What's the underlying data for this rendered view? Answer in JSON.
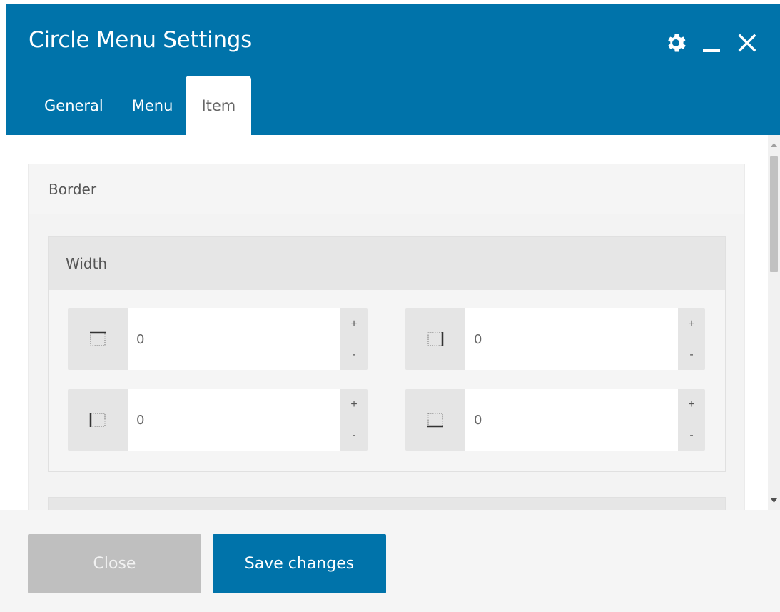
{
  "window": {
    "title": "Circle Menu Settings",
    "icons": [
      "gear-icon",
      "minimize-icon",
      "close-icon"
    ]
  },
  "tabs": [
    {
      "label": "General",
      "active": false
    },
    {
      "label": "Menu",
      "active": false
    },
    {
      "label": "Item",
      "active": true
    }
  ],
  "border_section": {
    "title": "Border",
    "width_panel": {
      "title": "Width",
      "fields": [
        {
          "side": "top",
          "icon": "border-top-icon",
          "value": "0",
          "plus": "+",
          "minus": "-"
        },
        {
          "side": "right",
          "icon": "border-right-icon",
          "value": "0",
          "plus": "+",
          "minus": "-"
        },
        {
          "side": "left",
          "icon": "border-left-icon",
          "value": "0",
          "plus": "+",
          "minus": "-"
        },
        {
          "side": "bottom",
          "icon": "border-bottom-icon",
          "value": "0",
          "plus": "+",
          "minus": "-"
        }
      ]
    }
  },
  "footer": {
    "close_label": "Close",
    "save_label": "Save changes"
  },
  "colors": {
    "accent": "#0073aa",
    "disabled_button": "#bfbfbf",
    "panel_header": "#e6e6e6"
  }
}
